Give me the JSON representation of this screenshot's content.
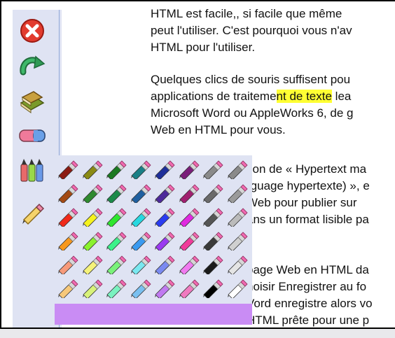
{
  "toolbar": {
    "tools": [
      {
        "name": "close-icon"
      },
      {
        "name": "redo-icon"
      },
      {
        "name": "books-icon"
      },
      {
        "name": "eraser-icon"
      },
      {
        "name": "markers-icon"
      },
      {
        "name": "pencil-icon"
      }
    ]
  },
  "document": {
    "para1": [
      "HTML est facile,, si facile que même",
      "peut l'utiliser. C'est pourquoi vous n'av",
      "HTML pour l'utiliser."
    ],
    "para2": {
      "line1": "Quelques clics de souris suffisent pou",
      "line2_pre": "applications de traiteme",
      "line2_hl": "nt de texte",
      "line2_post": " lea",
      "line3": "Microsoft Word ou AppleWorks 6, de g",
      "line4": "Web en HTML pour vous."
    },
    "behind_palette": [
      "tion de « Hypertext ma",
      "rguage hypertexte) », e",
      " Web pour publier sur",
      "ans un format lisible pa",
      "page Web en HTML da",
      "hoisir Enregistrer au fo",
      "Vord enregistre alors vo",
      "HTML prête pour une p"
    ]
  },
  "palette": {
    "rows": [
      [
        "#8b1a12",
        "#8a8a14",
        "#1b7a22",
        "#1a7f86",
        "#1e2f9a",
        "#7a1e7a",
        "#8a8a8a",
        "#8a8a8a"
      ],
      [
        "#a34a14",
        "#2f8a2f",
        "#1c8a4a",
        "#1f5fa0",
        "#4e2a9a",
        "#a02070",
        "#6a6a6a",
        "#9a9a9a"
      ],
      [
        "#f02a1a",
        "#f5f21e",
        "#2fe62f",
        "#28d8e0",
        "#2a3cf0",
        "#e02ae0",
        "#555555",
        "#bbbbbb"
      ],
      [
        "#f7981e",
        "#8af22e",
        "#3af28a",
        "#3a9af0",
        "#9a3af0",
        "#f03a9a",
        "#3a3a3a",
        "#d0d0d0"
      ],
      [
        "#f79a7a",
        "#f5f27a",
        "#7af27a",
        "#7ae8f0",
        "#7a8af0",
        "#f07af0",
        "#1a1a1a",
        "#e5e5e5"
      ],
      [
        "#f7c87a",
        "#d8f27a",
        "#7af2c0",
        "#7ac0f0",
        "#c07af0",
        "#f07ac0",
        "#000000",
        "#ffffff"
      ]
    ],
    "bar_color": "#c98cf4"
  }
}
